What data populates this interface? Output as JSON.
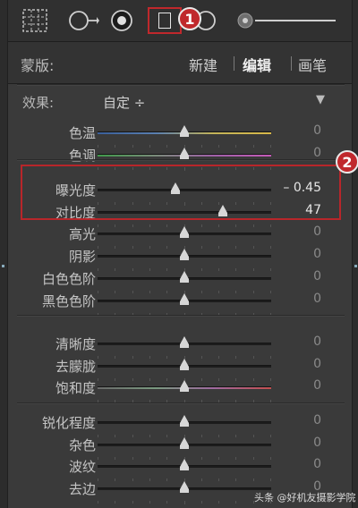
{
  "toolbar": {
    "tools": [
      {
        "name": "grid-crop-icon"
      },
      {
        "name": "spot-removal-icon"
      },
      {
        "name": "red-eye-icon"
      },
      {
        "name": "graduated-filter-icon",
        "selected": true
      },
      {
        "name": "radial-filter-icon"
      },
      {
        "name": "brush-size-slider"
      }
    ],
    "badge1": "1"
  },
  "mask": {
    "label": "蒙版:",
    "new": "新建",
    "edit": "编辑",
    "brush": "画笔"
  },
  "effect": {
    "label": "效果:",
    "value": "自定 ÷",
    "menu": "▼"
  },
  "badge2": "2",
  "groups": [
    {
      "rows": [
        {
          "label": "色温",
          "value": "0",
          "pos": 0.5,
          "track": "temp"
        },
        {
          "label": "色调",
          "value": "0",
          "pos": 0.5,
          "track": "tint"
        }
      ]
    },
    {
      "rows": [
        {
          "label": "曝光度",
          "value": "– 0.45",
          "pos": 0.45,
          "highlight": true
        },
        {
          "label": "对比度",
          "value": "47",
          "pos": 0.72,
          "highlight": true
        },
        {
          "label": "高光",
          "value": "0",
          "pos": 0.5
        },
        {
          "label": "阴影",
          "value": "0",
          "pos": 0.5
        },
        {
          "label": "白色色阶",
          "value": "0",
          "pos": 0.5
        },
        {
          "label": "黑色色阶",
          "value": "0",
          "pos": 0.5
        }
      ]
    },
    {
      "rows": [
        {
          "label": "清晰度",
          "value": "0",
          "pos": 0.5
        },
        {
          "label": "去朦胧",
          "value": "0",
          "pos": 0.5
        },
        {
          "label": "饱和度",
          "value": "0",
          "pos": 0.5,
          "track": "sat"
        }
      ]
    },
    {
      "rows": [
        {
          "label": "锐化程度",
          "value": "0",
          "pos": 0.5
        },
        {
          "label": "杂色",
          "value": "0",
          "pos": 0.5
        },
        {
          "label": "波纹",
          "value": "0",
          "pos": 0.5
        },
        {
          "label": "去边",
          "value": "0",
          "pos": 0.5
        }
      ]
    }
  ],
  "watermark": "头条 @好机友摄影学院"
}
